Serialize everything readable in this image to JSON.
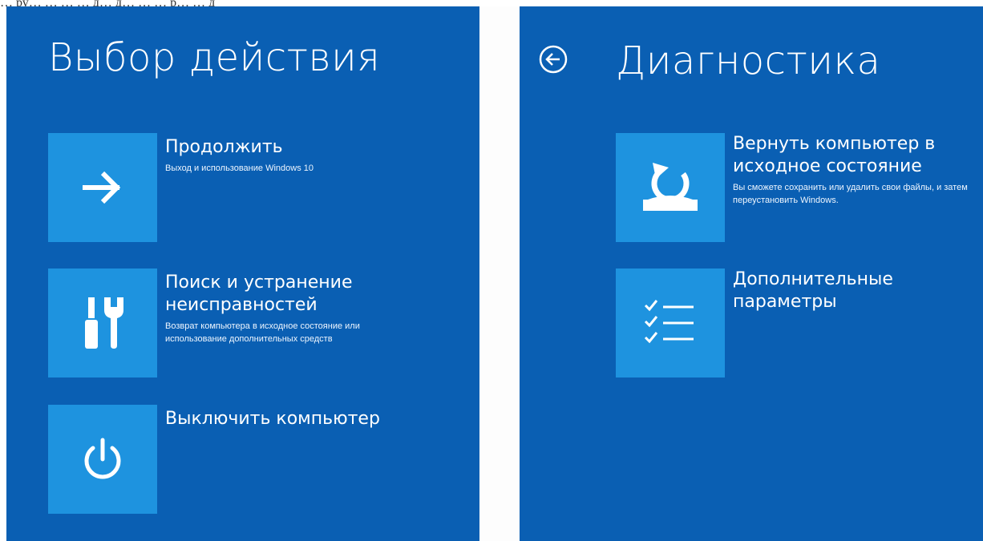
{
  "top_strip_text": "… ру… … … … д… д… … … р… … д",
  "left_panel": {
    "title": "Выбор действия",
    "options": [
      {
        "title": "Продолжить",
        "desc": "Выход и использование Windows 10",
        "icon": "arrow-right-icon"
      },
      {
        "title": "Поиск и устранение неисправностей",
        "desc": "Возврат компьютера в исходное состояние или использование дополнительных средств",
        "icon": "tools-icon"
      },
      {
        "title": "Выключить компьютер",
        "desc": "",
        "icon": "power-icon"
      }
    ]
  },
  "right_panel": {
    "title": "Диагностика",
    "back_icon": "back-arrow-circle-icon",
    "options": [
      {
        "title": "Вернуть компьютер в исходное состояние",
        "desc": "Вы сможете сохранить или удалить свои файлы, и затем переустановить Windows.",
        "icon": "reset-pc-icon"
      },
      {
        "title": "Дополнительные параметры",
        "desc": "",
        "icon": "checklist-icon"
      }
    ]
  },
  "colors": {
    "panel_background": "#0a5fb3",
    "tile_background": "#1e93df",
    "text": "#ffffff",
    "separator": "#fdfdfd"
  }
}
